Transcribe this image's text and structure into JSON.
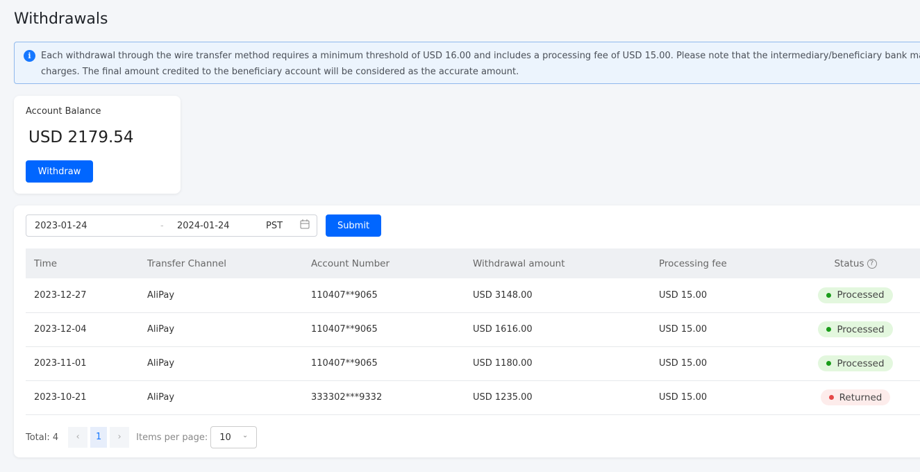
{
  "title": "Withdrawals",
  "notice": {
    "line1": "Each withdrawal through the wire transfer method requires a minimum threshold of USD 16.00 and includes a processing fee of USD 15.00. Please note that the intermediary/beneficiary bank ma",
    "line2": "charges. The final amount credited to the beneficiary account will be considered as the accurate amount."
  },
  "balance": {
    "label": "Account Balance",
    "amount": "USD 2179.54",
    "withdraw_label": "Withdraw"
  },
  "filter": {
    "start": "2023-01-24",
    "separator": "-",
    "end": "2024-01-24",
    "timezone": "PST",
    "submit_label": "Submit"
  },
  "table": {
    "headers": [
      "Time",
      "Transfer Channel",
      "Account Number",
      "Withdrawal amount",
      "Processing fee",
      "Status"
    ],
    "rows": [
      {
        "time": "2023-12-27",
        "channel": "AliPay",
        "account": "110407**9065",
        "amount": "USD 3148.00",
        "fee": "USD 15.00",
        "status": "Processed"
      },
      {
        "time": "2023-12-04",
        "channel": "AliPay",
        "account": "110407**9065",
        "amount": "USD 1616.00",
        "fee": "USD 15.00",
        "status": "Processed"
      },
      {
        "time": "2023-11-01",
        "channel": "AliPay",
        "account": "110407**9065",
        "amount": "USD 1180.00",
        "fee": "USD 15.00",
        "status": "Processed"
      },
      {
        "time": "2023-10-21",
        "channel": "AliPay",
        "account": "333302***9332",
        "amount": "USD 1235.00",
        "fee": "USD 15.00",
        "status": "Returned"
      }
    ]
  },
  "status_colors": {
    "Processed": {
      "bg": "#e3f7de",
      "dot": "#1a9c1a"
    },
    "Returned": {
      "bg": "#fdeceb",
      "dot": "#e54848"
    }
  },
  "pagination": {
    "total": "Total: 4",
    "page": "1",
    "items_label": "Items per page:",
    "page_size": "10"
  }
}
